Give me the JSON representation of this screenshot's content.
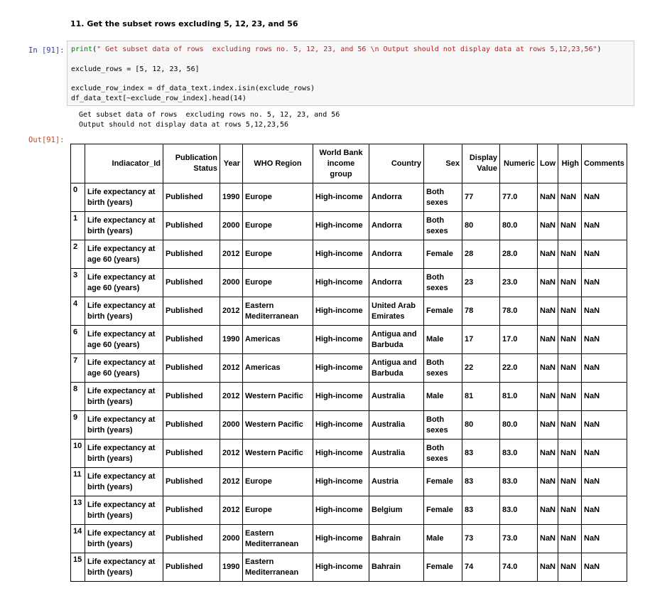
{
  "heading": "11. Get the subset rows excluding 5, 12, 23, and 56",
  "prompt_in": "In [91]:",
  "prompt_out": "Out[91]:",
  "code": {
    "l1_fn": "print",
    "l1_open": "(",
    "l1_str": "\" Get subset data of rows  excluding rows no. 5, 12, 23, and 56 \\n Output should not display data at rows 5,12,23,56\"",
    "l1_close": ")",
    "l2": "exclude_rows = [5, 12, 23, 56]",
    "l3": "exclude_row_index = df_data_text.index.isin(exclude_rows)",
    "l4": "df_data_text[~exclude_row_index].head(14)"
  },
  "stdout": [
    " Get subset data of rows  excluding rows no. 5, 12, 23, and 56",
    " Output should not display data at rows 5,12,23,56"
  ],
  "columns": {
    "indicator": "Indiacator_Id",
    "pub_status": "Publication Status",
    "year": "Year",
    "who_region": "WHO Region",
    "wb_income": "World Bank income group",
    "country": "Country",
    "sex": "Sex",
    "display_value": "Display Value",
    "numeric": "Numeric",
    "low": "Low",
    "high": "High",
    "comments": "Comments"
  },
  "rows": [
    {
      "idx": "0",
      "indicator": "Life expectancy at birth (years)",
      "status": "Published",
      "year": "1990",
      "region": "Europe",
      "income": "High-income",
      "country": "Andorra",
      "sex": "Both sexes",
      "display": "77",
      "numeric": "77.0",
      "low": "NaN",
      "high": "NaN",
      "comments": "NaN"
    },
    {
      "idx": "1",
      "indicator": "Life expectancy at birth (years)",
      "status": "Published",
      "year": "2000",
      "region": "Europe",
      "income": "High-income",
      "country": "Andorra",
      "sex": "Both sexes",
      "display": "80",
      "numeric": "80.0",
      "low": "NaN",
      "high": "NaN",
      "comments": "NaN"
    },
    {
      "idx": "2",
      "indicator": "Life expectancy at age 60 (years)",
      "status": "Published",
      "year": "2012",
      "region": "Europe",
      "income": "High-income",
      "country": "Andorra",
      "sex": "Female",
      "display": "28",
      "numeric": "28.0",
      "low": "NaN",
      "high": "NaN",
      "comments": "NaN"
    },
    {
      "idx": "3",
      "indicator": "Life expectancy at age 60 (years)",
      "status": "Published",
      "year": "2000",
      "region": "Europe",
      "income": "High-income",
      "country": "Andorra",
      "sex": "Both sexes",
      "display": "23",
      "numeric": "23.0",
      "low": "NaN",
      "high": "NaN",
      "comments": "NaN"
    },
    {
      "idx": "4",
      "indicator": "Life expectancy at birth (years)",
      "status": "Published",
      "year": "2012",
      "region": "Eastern Mediterranean",
      "income": "High-income",
      "country": "United Arab Emirates",
      "sex": "Female",
      "display": "78",
      "numeric": "78.0",
      "low": "NaN",
      "high": "NaN",
      "comments": "NaN"
    },
    {
      "idx": "6",
      "indicator": "Life expectancy at age 60 (years)",
      "status": "Published",
      "year": "1990",
      "region": "Americas",
      "income": "High-income",
      "country": "Antigua and Barbuda",
      "sex": "Male",
      "display": "17",
      "numeric": "17.0",
      "low": "NaN",
      "high": "NaN",
      "comments": "NaN"
    },
    {
      "idx": "7",
      "indicator": "Life expectancy at age 60 (years)",
      "status": "Published",
      "year": "2012",
      "region": "Americas",
      "income": "High-income",
      "country": "Antigua and Barbuda",
      "sex": "Both sexes",
      "display": "22",
      "numeric": "22.0",
      "low": "NaN",
      "high": "NaN",
      "comments": "NaN"
    },
    {
      "idx": "8",
      "indicator": "Life expectancy at birth (years)",
      "status": "Published",
      "year": "2012",
      "region": "Western Pacific",
      "income": "High-income",
      "country": "Australia",
      "sex": "Male",
      "display": "81",
      "numeric": "81.0",
      "low": "NaN",
      "high": "NaN",
      "comments": "NaN"
    },
    {
      "idx": "9",
      "indicator": "Life expectancy at birth (years)",
      "status": "Published",
      "year": "2000",
      "region": "Western Pacific",
      "income": "High-income",
      "country": "Australia",
      "sex": "Both sexes",
      "display": "80",
      "numeric": "80.0",
      "low": "NaN",
      "high": "NaN",
      "comments": "NaN"
    },
    {
      "idx": "10",
      "indicator": "Life expectancy at birth (years)",
      "status": "Published",
      "year": "2012",
      "region": "Western Pacific",
      "income": "High-income",
      "country": "Australia",
      "sex": "Both sexes",
      "display": "83",
      "numeric": "83.0",
      "low": "NaN",
      "high": "NaN",
      "comments": "NaN"
    },
    {
      "idx": "11",
      "indicator": "Life expectancy at birth (years)",
      "status": "Published",
      "year": "2012",
      "region": "Europe",
      "income": "High-income",
      "country": "Austria",
      "sex": "Female",
      "display": "83",
      "numeric": "83.0",
      "low": "NaN",
      "high": "NaN",
      "comments": "NaN"
    },
    {
      "idx": "13",
      "indicator": "Life expectancy at birth (years)",
      "status": "Published",
      "year": "2012",
      "region": "Europe",
      "income": "High-income",
      "country": "Belgium",
      "sex": "Female",
      "display": "83",
      "numeric": "83.0",
      "low": "NaN",
      "high": "NaN",
      "comments": "NaN"
    },
    {
      "idx": "14",
      "indicator": "Life expectancy at birth (years)",
      "status": "Published",
      "year": "2000",
      "region": "Eastern Mediterranean",
      "income": "High-income",
      "country": "Bahrain",
      "sex": "Male",
      "display": "73",
      "numeric": "73.0",
      "low": "NaN",
      "high": "NaN",
      "comments": "NaN"
    },
    {
      "idx": "15",
      "indicator": "Life expectancy at birth (years)",
      "status": "Published",
      "year": "1990",
      "region": "Eastern Mediterranean",
      "income": "High-income",
      "country": "Bahrain",
      "sex": "Female",
      "display": "74",
      "numeric": "74.0",
      "low": "NaN",
      "high": "NaN",
      "comments": "NaN"
    }
  ]
}
